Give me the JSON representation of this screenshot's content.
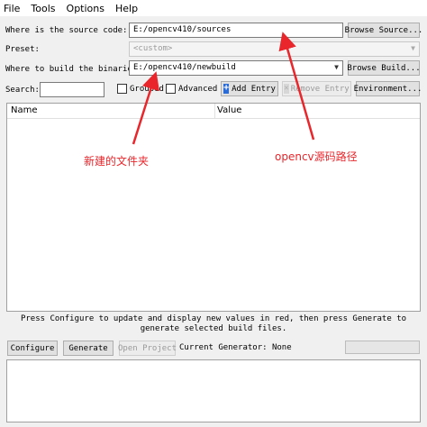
{
  "menu": [
    "File",
    "Tools",
    "Options",
    "Help"
  ],
  "source": {
    "label": "Where is the source code:",
    "value": "E:/opencv410/sources",
    "browse": "Browse Source..."
  },
  "preset": {
    "label": "Preset:",
    "value": "<custom>"
  },
  "build": {
    "label": "Where to build the binaries:",
    "value": "E:/opencv410/newbuild",
    "browse": "Browse Build..."
  },
  "search": {
    "label": "Search:",
    "value": ""
  },
  "grouped": {
    "label": "Grouped",
    "checked": false
  },
  "advanced": {
    "label": "Advanced",
    "checked": false
  },
  "add_entry": "Add Entry",
  "remove_entry": "Remove Entry",
  "environment": "Environment...",
  "table": {
    "columns": [
      "Name",
      "Value"
    ]
  },
  "hint": "Press Configure to update and display new values in red, then press Generate to generate selected build files.",
  "buttons": {
    "configure": "Configure",
    "generate": "Generate",
    "open_project": "Open Project"
  },
  "generator": "Current Generator: None",
  "annotations": {
    "build_note": "新建的文件夹",
    "source_note": "opencv源码路径"
  },
  "colors": {
    "annotation": "#e8262b",
    "add_icon": "#2a6bd6"
  }
}
